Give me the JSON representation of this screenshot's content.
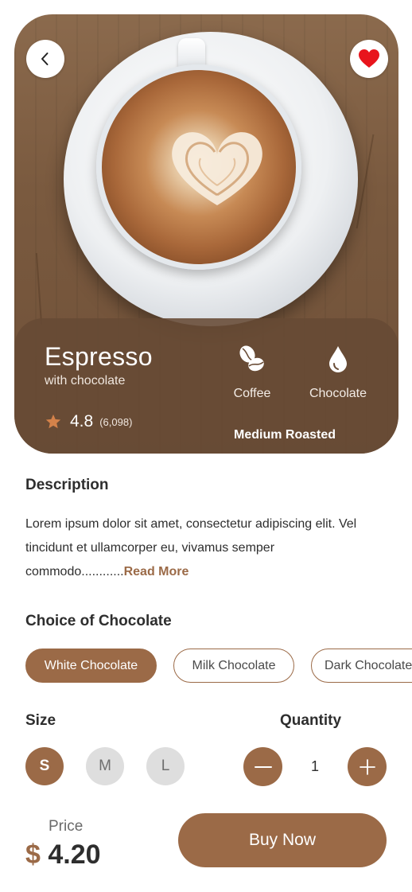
{
  "product": {
    "name": "Espresso",
    "subtitle": "with chocolate",
    "rating": "4.8",
    "rating_count": "(6,098)",
    "attributes": [
      {
        "label": "Coffee",
        "icon": "coffee-beans-icon"
      },
      {
        "label": "Chocolate",
        "icon": "drop-icon"
      }
    ],
    "roast": "Medium Roasted",
    "favorite": true
  },
  "description": {
    "heading": "Description",
    "text": "Lorem ipsum dolor sit amet, consectetur adipiscing elit. Vel tincidunt et ullamcorper eu, vivamus semper commodo............",
    "read_more": "Read More"
  },
  "chocolate": {
    "heading": "Choice of Chocolate",
    "options": [
      "White Chocolate",
      "Milk Chocolate",
      "Dark Chocolate"
    ],
    "selected": "White Chocolate"
  },
  "size": {
    "heading": "Size",
    "options": [
      "S",
      "M",
      "L"
    ],
    "selected": "S"
  },
  "quantity": {
    "heading": "Quantity",
    "value": "1"
  },
  "price": {
    "label": "Price",
    "currency": "$",
    "amount": "4.20"
  },
  "buy_label": "Buy Now",
  "colors": {
    "accent": "#9b6a47",
    "panel": "#664a34",
    "favorite": "#e8141c",
    "idle_chip": "#dedede"
  }
}
